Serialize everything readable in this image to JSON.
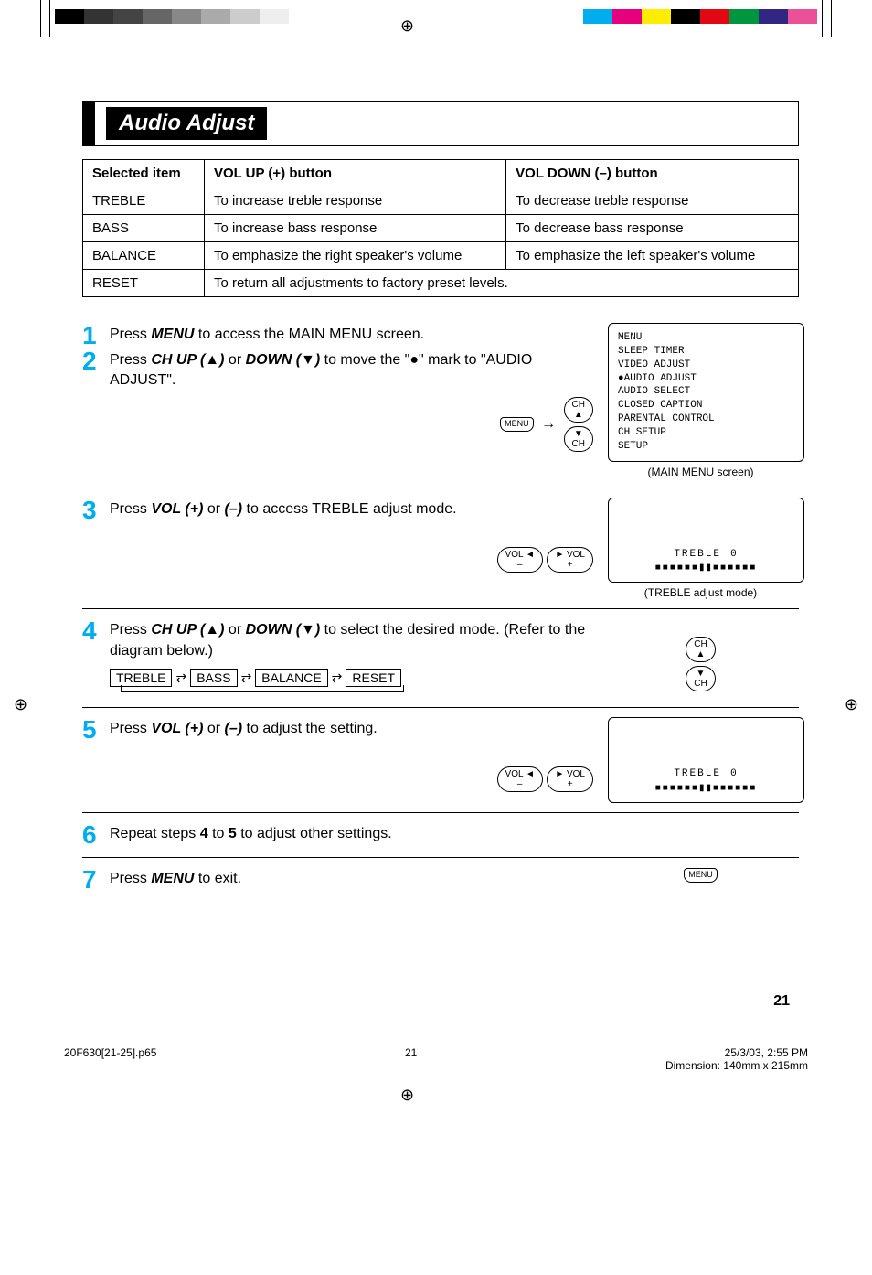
{
  "title": "Audio Adjust",
  "table": {
    "headers": [
      "Selected item",
      "VOL UP (+) button",
      "VOL DOWN (–) button"
    ],
    "rows": [
      [
        "TREBLE",
        "To increase treble response",
        "To decrease treble response"
      ],
      [
        "BASS",
        "To increase bass response",
        "To decrease bass response"
      ],
      [
        "BALANCE",
        "To emphasize the right speaker's volume",
        "To emphasize the left speaker's volume"
      ],
      [
        "RESET",
        "To return all adjustments to factory preset levels.",
        ""
      ]
    ]
  },
  "steps": {
    "s1": {
      "num": "1",
      "pre": "Press ",
      "key": "MENU",
      "post": " to access the MAIN MENU screen."
    },
    "s2": {
      "num": "2",
      "p1": "Press ",
      "k1": "CH UP (▲)",
      "p2": " or ",
      "k2": "DOWN (▼)",
      "p3": " to move the \"●\" mark to \"AUDIO ADJUST\"."
    },
    "s3": {
      "num": "3",
      "p1": "Press ",
      "k1": "VOL (+)",
      "p2": " or ",
      "k2": "(–)",
      "p3": " to access TREBLE adjust mode."
    },
    "s4": {
      "num": "4",
      "p1": "Press ",
      "k1": "CH UP (▲)",
      "p2": " or ",
      "k2": "DOWN (▼)",
      "p3": " to select the desired mode. (Refer to the diagram below.)",
      "flow": [
        "TREBLE",
        "BASS",
        "BALANCE",
        "RESET"
      ]
    },
    "s5": {
      "num": "5",
      "p1": "Press ",
      "k1": "VOL (+)",
      "p2": " or ",
      "k2": "(–)",
      "p3": " to adjust the setting."
    },
    "s6": {
      "num": "6",
      "p1": "Repeat steps ",
      "b1": "4",
      "p2": " to ",
      "b2": "5",
      "p3": " to adjust other settings."
    },
    "s7": {
      "num": "7",
      "p1": "Press ",
      "k1": "MENU",
      "p2": " to exit."
    }
  },
  "menu_screen": {
    "title": "MENU",
    "items": [
      " SLEEP TIMER",
      " VIDEO ADJUST",
      "●AUDIO ADJUST",
      " AUDIO SELECT",
      " CLOSED CAPTION",
      " PARENTAL CONTROL",
      " CH SETUP",
      " SETUP"
    ],
    "caption": "(MAIN MENU screen)"
  },
  "treble_screen": {
    "label": "TREBLE",
    "value": "0",
    "caption": "(TREBLE adjust mode)"
  },
  "treble_screen2": {
    "label": "TREBLE",
    "value": "0"
  },
  "keys": {
    "menu": "MENU",
    "ch_up": "CH\n▲",
    "ch_down": "▼\nCH",
    "vol_minus": "VOL ◄\n–",
    "vol_plus": "► VOL\n+"
  },
  "page_number": "21",
  "footer": {
    "file": "20F630[21-25].p65",
    "page": "21",
    "date": "25/3/03, 2:55 PM",
    "dim": "Dimension: 140mm x 215mm"
  }
}
